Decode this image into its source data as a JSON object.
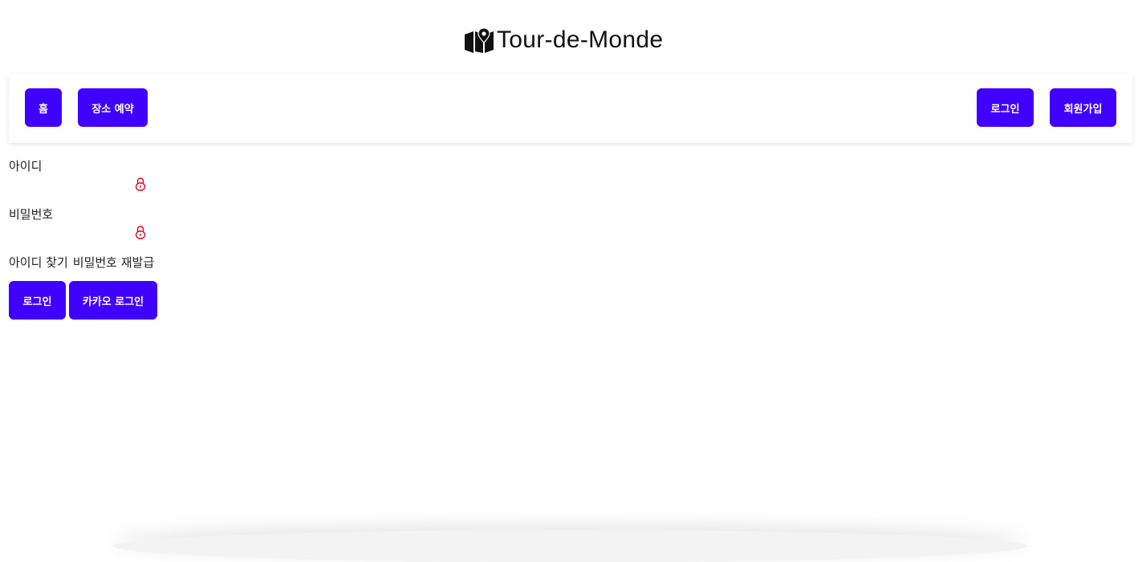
{
  "header": {
    "logo_text": "Tour-de-Monde",
    "logo_icon": "map-pin-icon"
  },
  "nav": {
    "home": "홈",
    "reserve": "장소 예약",
    "login": "로그인",
    "signup": "회원가입"
  },
  "form": {
    "id_label": "아이디",
    "pw_label": "비밀번호",
    "lock_icon": "lock-icon",
    "find_id": "아이디 찾기",
    "reset_pw": "비밀번호 재발급",
    "login_button": "로그인",
    "kakao_login_button": "카카오 로그인"
  },
  "colors": {
    "primary": "#4000ff",
    "lock": "#e0001b",
    "text": "#222222"
  }
}
